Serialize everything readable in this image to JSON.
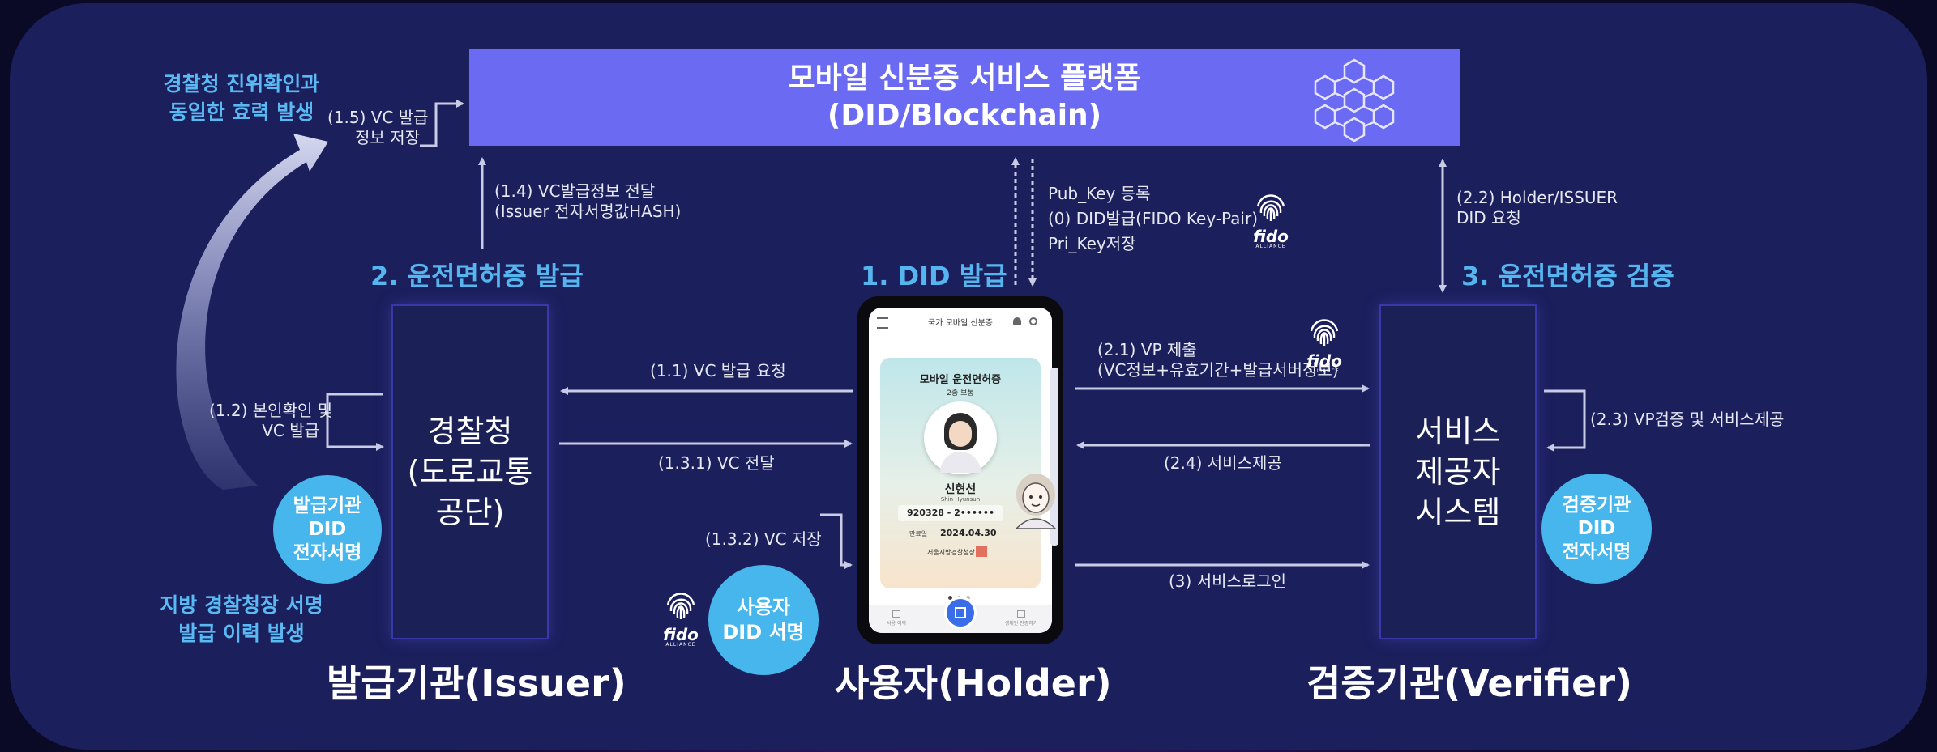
{
  "platform": {
    "title": "모바일 신분증 서비스 플랫폼",
    "subtitle": "(DID/Blockchain)",
    "icon": "blockchain-cubes-icon"
  },
  "phases": {
    "p1": "1. DID 발급",
    "p2": "2. 운전면허증 발급",
    "p3": "3. 운전면허증 검증"
  },
  "issuer": {
    "box_line1": "경찰청",
    "box_line2": "(도로교통",
    "box_line3": "공단)",
    "label": "발급기관(Issuer)",
    "badge_line1": "발급기관",
    "badge_line2": "DID",
    "badge_line3": "전자서명"
  },
  "holder": {
    "label": "사용자(Holder)",
    "badge_line1": "사용자",
    "badge_line2": "DID 서명"
  },
  "verifier": {
    "box_line1": "서비스",
    "box_line2": "제공자",
    "box_line3": "시스템",
    "label": "검증기관(Verifier)",
    "badge_line1": "검증기관",
    "badge_line2": "DID",
    "badge_line3": "전자서명"
  },
  "notes": {
    "top_left_line1": "경찰청 진위확인과",
    "top_left_line2": "동일한 효력 발생",
    "bottom_left_line1": "지방 경찰청장 서명",
    "bottom_left_line2": "발급 이력 발생"
  },
  "steps": {
    "s1_5_line1": "(1.5) VC 발급",
    "s1_5_line2": "정보 저장",
    "s1_4_line1": "(1.4) VC발급정보 전달",
    "s1_4_line2": "(Issuer 전자서명값HASH)",
    "s0_line1": "Pub_Key 등록",
    "s0_line2": "(0) DID발급(FIDO Key-Pair)",
    "s0_line3": "Pri_Key저장",
    "s2_2_line1": "(2.2) Holder/ISSUER",
    "s2_2_line2": "DID 요청",
    "s1_1": "(1.1) VC 발급 요청",
    "s1_2_line1": "(1.2) 본인확인 및",
    "s1_2_line2": "VC 발급",
    "s1_3_1": "(1.3.1) VC 전달",
    "s1_3_2": "(1.3.2) VC 저장",
    "s2_1_line1": "(2.1) VP 제출",
    "s2_1_line2": "(VC정보+유효기간+발급서버정보)",
    "s2_3": "(2.3) VP검증 및 서비스제공",
    "s2_4": "(2.4) 서비스제공",
    "s3": "(3) 서비스로그인"
  },
  "fido": {
    "text": "fido",
    "sub": "ALLIANCE",
    "icon": "fingerprint-icon"
  },
  "phone": {
    "app_title": "국가 모바일 신분증",
    "card_title": "모바일 운전면허증",
    "card_class": "2종 보통",
    "name": "신현선",
    "name_en": "Shin Hyunsun",
    "id_number": "920328 - 2••••••",
    "expiry_label": "만료일",
    "expiry_date": "2024.04.30",
    "issuer_text": "서울지방경찰청장",
    "nav_left": "사용 이력",
    "nav_right": "생체인 인증하기"
  },
  "colors": {
    "panel": "#1b1f5c",
    "platform": "#6b6af2",
    "accent_blue": "#56b4ee",
    "badge": "#47b6ec",
    "arrow": "#c9cce6"
  }
}
